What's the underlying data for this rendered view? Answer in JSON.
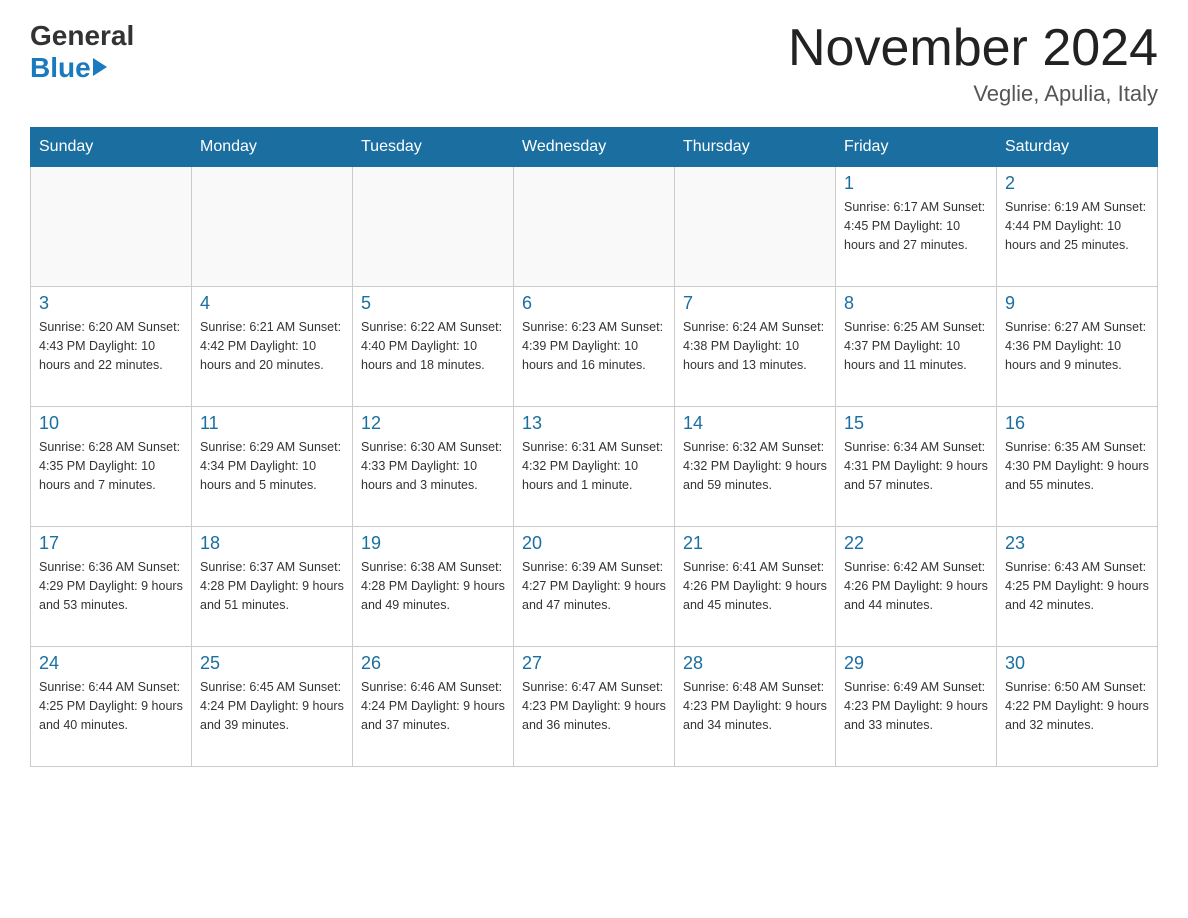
{
  "header": {
    "logo_line1": "General",
    "logo_line2": "Blue",
    "title": "November 2024",
    "subtitle": "Veglie, Apulia, Italy"
  },
  "weekdays": [
    "Sunday",
    "Monday",
    "Tuesday",
    "Wednesday",
    "Thursday",
    "Friday",
    "Saturday"
  ],
  "weeks": [
    [
      {
        "day": "",
        "info": ""
      },
      {
        "day": "",
        "info": ""
      },
      {
        "day": "",
        "info": ""
      },
      {
        "day": "",
        "info": ""
      },
      {
        "day": "",
        "info": ""
      },
      {
        "day": "1",
        "info": "Sunrise: 6:17 AM\nSunset: 4:45 PM\nDaylight: 10 hours\nand 27 minutes."
      },
      {
        "day": "2",
        "info": "Sunrise: 6:19 AM\nSunset: 4:44 PM\nDaylight: 10 hours\nand 25 minutes."
      }
    ],
    [
      {
        "day": "3",
        "info": "Sunrise: 6:20 AM\nSunset: 4:43 PM\nDaylight: 10 hours\nand 22 minutes."
      },
      {
        "day": "4",
        "info": "Sunrise: 6:21 AM\nSunset: 4:42 PM\nDaylight: 10 hours\nand 20 minutes."
      },
      {
        "day": "5",
        "info": "Sunrise: 6:22 AM\nSunset: 4:40 PM\nDaylight: 10 hours\nand 18 minutes."
      },
      {
        "day": "6",
        "info": "Sunrise: 6:23 AM\nSunset: 4:39 PM\nDaylight: 10 hours\nand 16 minutes."
      },
      {
        "day": "7",
        "info": "Sunrise: 6:24 AM\nSunset: 4:38 PM\nDaylight: 10 hours\nand 13 minutes."
      },
      {
        "day": "8",
        "info": "Sunrise: 6:25 AM\nSunset: 4:37 PM\nDaylight: 10 hours\nand 11 minutes."
      },
      {
        "day": "9",
        "info": "Sunrise: 6:27 AM\nSunset: 4:36 PM\nDaylight: 10 hours\nand 9 minutes."
      }
    ],
    [
      {
        "day": "10",
        "info": "Sunrise: 6:28 AM\nSunset: 4:35 PM\nDaylight: 10 hours\nand 7 minutes."
      },
      {
        "day": "11",
        "info": "Sunrise: 6:29 AM\nSunset: 4:34 PM\nDaylight: 10 hours\nand 5 minutes."
      },
      {
        "day": "12",
        "info": "Sunrise: 6:30 AM\nSunset: 4:33 PM\nDaylight: 10 hours\nand 3 minutes."
      },
      {
        "day": "13",
        "info": "Sunrise: 6:31 AM\nSunset: 4:32 PM\nDaylight: 10 hours\nand 1 minute."
      },
      {
        "day": "14",
        "info": "Sunrise: 6:32 AM\nSunset: 4:32 PM\nDaylight: 9 hours\nand 59 minutes."
      },
      {
        "day": "15",
        "info": "Sunrise: 6:34 AM\nSunset: 4:31 PM\nDaylight: 9 hours\nand 57 minutes."
      },
      {
        "day": "16",
        "info": "Sunrise: 6:35 AM\nSunset: 4:30 PM\nDaylight: 9 hours\nand 55 minutes."
      }
    ],
    [
      {
        "day": "17",
        "info": "Sunrise: 6:36 AM\nSunset: 4:29 PM\nDaylight: 9 hours\nand 53 minutes."
      },
      {
        "day": "18",
        "info": "Sunrise: 6:37 AM\nSunset: 4:28 PM\nDaylight: 9 hours\nand 51 minutes."
      },
      {
        "day": "19",
        "info": "Sunrise: 6:38 AM\nSunset: 4:28 PM\nDaylight: 9 hours\nand 49 minutes."
      },
      {
        "day": "20",
        "info": "Sunrise: 6:39 AM\nSunset: 4:27 PM\nDaylight: 9 hours\nand 47 minutes."
      },
      {
        "day": "21",
        "info": "Sunrise: 6:41 AM\nSunset: 4:26 PM\nDaylight: 9 hours\nand 45 minutes."
      },
      {
        "day": "22",
        "info": "Sunrise: 6:42 AM\nSunset: 4:26 PM\nDaylight: 9 hours\nand 44 minutes."
      },
      {
        "day": "23",
        "info": "Sunrise: 6:43 AM\nSunset: 4:25 PM\nDaylight: 9 hours\nand 42 minutes."
      }
    ],
    [
      {
        "day": "24",
        "info": "Sunrise: 6:44 AM\nSunset: 4:25 PM\nDaylight: 9 hours\nand 40 minutes."
      },
      {
        "day": "25",
        "info": "Sunrise: 6:45 AM\nSunset: 4:24 PM\nDaylight: 9 hours\nand 39 minutes."
      },
      {
        "day": "26",
        "info": "Sunrise: 6:46 AM\nSunset: 4:24 PM\nDaylight: 9 hours\nand 37 minutes."
      },
      {
        "day": "27",
        "info": "Sunrise: 6:47 AM\nSunset: 4:23 PM\nDaylight: 9 hours\nand 36 minutes."
      },
      {
        "day": "28",
        "info": "Sunrise: 6:48 AM\nSunset: 4:23 PM\nDaylight: 9 hours\nand 34 minutes."
      },
      {
        "day": "29",
        "info": "Sunrise: 6:49 AM\nSunset: 4:23 PM\nDaylight: 9 hours\nand 33 minutes."
      },
      {
        "day": "30",
        "info": "Sunrise: 6:50 AM\nSunset: 4:22 PM\nDaylight: 9 hours\nand 32 minutes."
      }
    ]
  ],
  "colors": {
    "header_bg": "#1a6fa0",
    "day_number": "#1a6fa0",
    "logo_black": "#333333",
    "logo_blue": "#1a7abf"
  }
}
